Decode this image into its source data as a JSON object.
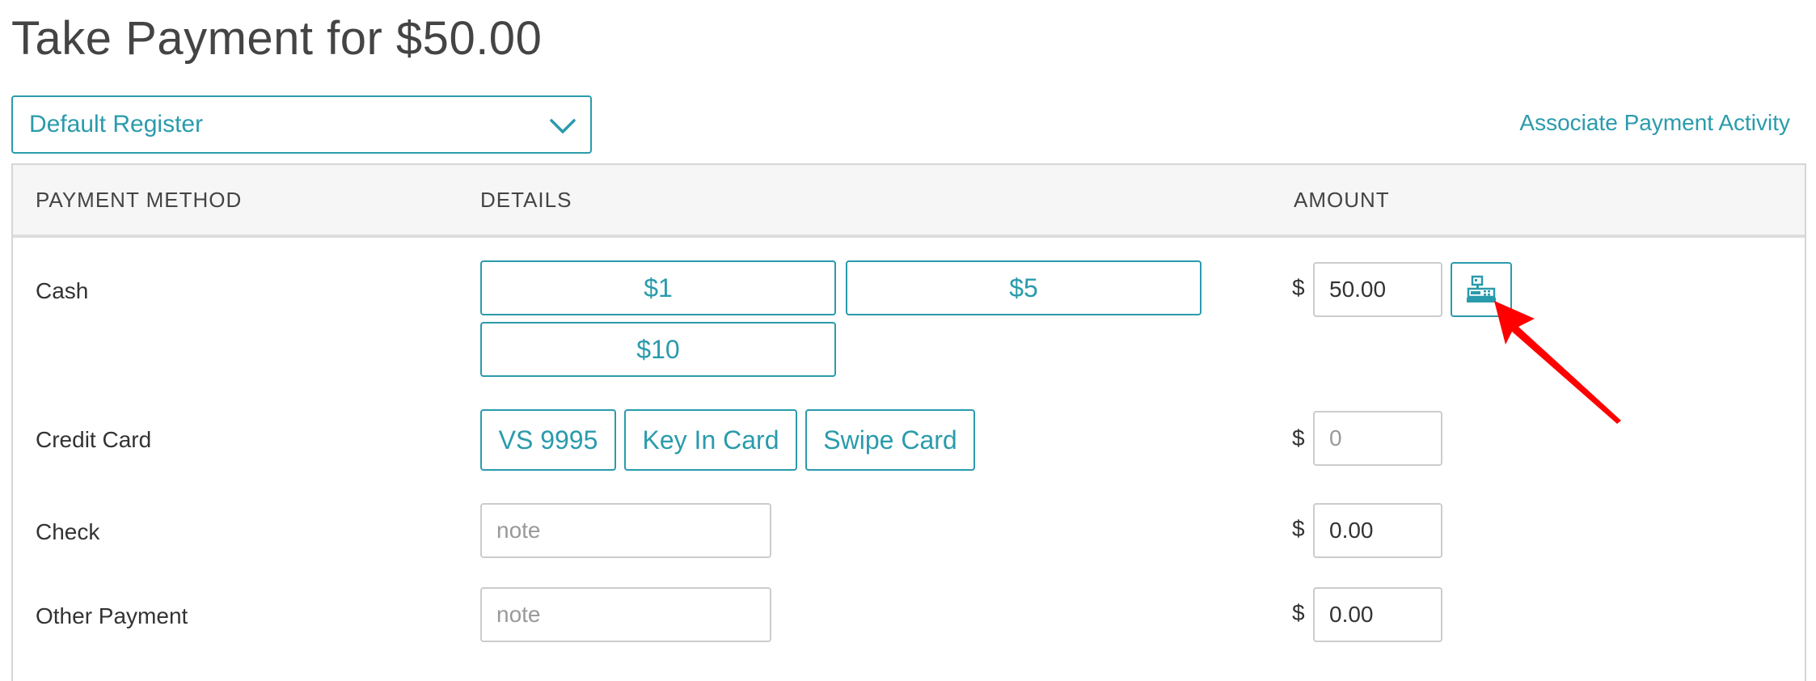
{
  "page": {
    "title": "Take Payment for $50.00"
  },
  "register": {
    "selected": "Default Register"
  },
  "links": {
    "associate": "Associate Payment Activity"
  },
  "table": {
    "headers": [
      "PAYMENT METHOD",
      "DETAILS",
      "AMOUNT"
    ],
    "currency_symbol": "$"
  },
  "rows": {
    "cash": {
      "label": "Cash",
      "quick_buttons": [
        "$1",
        "$5",
        "$10"
      ],
      "amount": "50.00"
    },
    "credit": {
      "label": "Credit Card",
      "buttons": [
        "VS 9995",
        "Key In Card",
        "Swipe Card"
      ],
      "amount_placeholder": "0"
    },
    "check": {
      "label": "Check",
      "note_placeholder": "note",
      "amount": "0.00"
    },
    "other": {
      "label": "Other Payment",
      "note_placeholder": "note",
      "amount": "0.00"
    }
  },
  "icons": {
    "register_button": "cash-register-icon",
    "dropdown": "chevron-down-icon",
    "annotation": "red-arrow"
  },
  "colors": {
    "accent": "#2a9bac",
    "annotation_arrow": "#ff0000",
    "header_bg": "#f6f6f6"
  }
}
